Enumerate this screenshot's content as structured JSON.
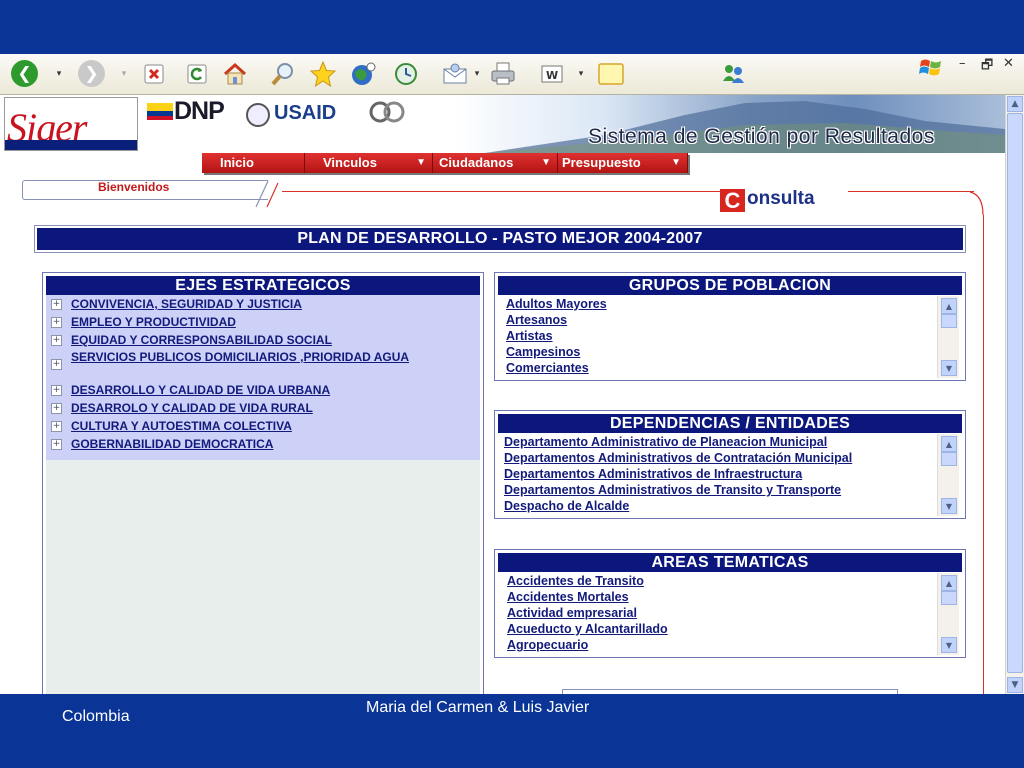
{
  "browser": {
    "window_controls": [
      "–",
      "🗗",
      "✕"
    ]
  },
  "site": {
    "logo_siger": "Siger",
    "logo_dnp": "DNP",
    "logo_usaid": "USAID",
    "title": "Sistema de Gestión por Resultados"
  },
  "menu": {
    "items": [
      {
        "label": "Inicio"
      },
      {
        "label": "Vinculos"
      },
      {
        "label": "Ciudadanos"
      },
      {
        "label": "Presupuesto"
      }
    ]
  },
  "welcome": "Bienvenidos",
  "consulta": {
    "initial": "C",
    "rest": "onsulta"
  },
  "plan_title": "PLAN DE DESARROLLO - PASTO MEJOR 2004-2007",
  "ejes": {
    "title": "EJES ESTRATEGICOS",
    "items": [
      "CONVIVENCIA, SEGURIDAD Y JUSTICIA",
      "EMPLEO Y PRODUCTIVIDAD",
      "EQUIDAD Y CORRESPONSABILIDAD SOCIAL",
      "SERVICIOS PUBLICOS DOMICILIARIOS ,PRIORIDAD AGUA",
      "DESARROLLO Y CALIDAD DE VIDA URBANA",
      "DESARROLO Y CALIDAD DE VIDA RURAL",
      "CULTURA Y AUTOESTIMA COLECTIVA",
      "GOBERNABILIDAD DEMOCRATICA"
    ]
  },
  "grupos": {
    "title": "GRUPOS DE POBLACION",
    "items": [
      "Adultos Mayores",
      "Artesanos",
      "Artistas",
      "Campesinos",
      "Comerciantes"
    ]
  },
  "dependencias": {
    "title": "DEPENDENCIAS / ENTIDADES",
    "items": [
      "Departamento Administrativo de Planeacion Municipal",
      "Departamentos Administrativos de Contratación Municipal",
      "Departamentos Administrativos de Infraestructura",
      "Departamentos Administrativos de Transito y Transporte",
      "Despacho de Alcalde"
    ]
  },
  "areas": {
    "title": "AREAS TEMATICAS",
    "items": [
      "Accidentes de Transito",
      "Accidentes Mortales",
      "Actividad empresarial",
      "Acueducto y Alcantarillado",
      "Agropecuario"
    ]
  },
  "footer": {
    "left": "Colombia",
    "center": "Maria del Carmen & Luis Javier"
  },
  "colors": {
    "slide_background": "#0a3496",
    "panel_header": "#0c177e",
    "menu_red": "#c21a1a",
    "link": "#121a7b"
  }
}
